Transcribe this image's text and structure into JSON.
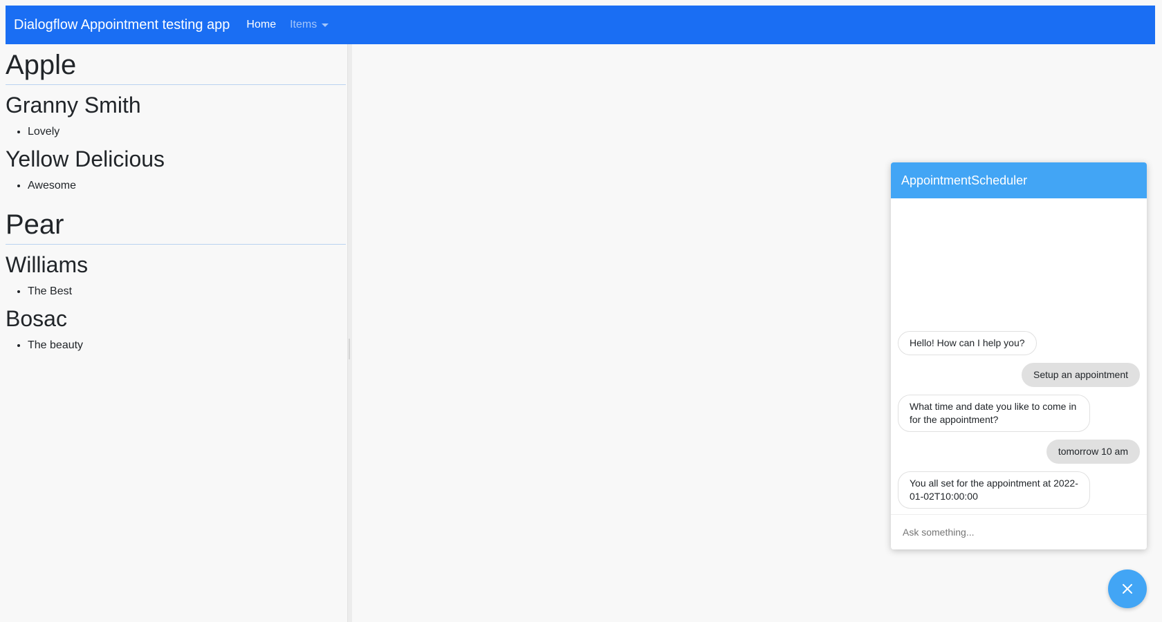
{
  "navbar": {
    "brand": "Dialogflow Appointment testing app",
    "links": [
      {
        "label": "Home"
      },
      {
        "label": "Items"
      }
    ]
  },
  "groups": [
    {
      "title": "Apple",
      "varieties": [
        {
          "name": "Granny Smith",
          "items": [
            "Lovely"
          ]
        },
        {
          "name": "Yellow Delicious",
          "items": [
            "Awesome"
          ]
        }
      ]
    },
    {
      "title": "Pear",
      "varieties": [
        {
          "name": "Williams",
          "items": [
            "The Best"
          ]
        },
        {
          "name": "Bosac",
          "items": [
            "The beauty"
          ]
        }
      ]
    }
  ],
  "chat": {
    "title": "AppointmentScheduler",
    "messages": [
      {
        "from": "bot",
        "text": "Hello! How can I help you?"
      },
      {
        "from": "user",
        "text": "Setup an appointment"
      },
      {
        "from": "bot",
        "text": "What time and date you like to come in for the appointment?"
      },
      {
        "from": "user",
        "text": "tomorrow 10 am"
      },
      {
        "from": "bot",
        "text": "You all set for the appointment at 2022-01-02T10:00:00"
      }
    ],
    "input": {
      "placeholder": "Ask something...",
      "value": ""
    },
    "fab_icon": "close-icon"
  },
  "colors": {
    "navbar": "#1a6ef3",
    "chat_accent": "#42a5f5",
    "user_bubble": "#e0e0e0"
  }
}
